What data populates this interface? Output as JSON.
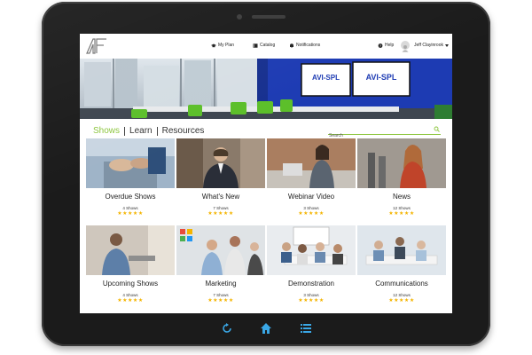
{
  "nav": {
    "my_plan": "My Plan",
    "catalog": "Catalog",
    "notifications": "Notifications",
    "help": "Help",
    "user_name": "Jeff Clayinrook"
  },
  "hero": {
    "sign_left": "AVI-SPL",
    "sign_right": "AVI-SPL"
  },
  "tabs": [
    {
      "label": "Shows",
      "active": true
    },
    {
      "label": "Learn",
      "active": false
    },
    {
      "label": "Resources",
      "active": false
    }
  ],
  "search": {
    "placeholder": "Search"
  },
  "cards": [
    {
      "title": "Overdue Shows",
      "count": "4 Shows",
      "rating": 5
    },
    {
      "title": "What's New",
      "count": "7 Shows",
      "rating": 5
    },
    {
      "title": "Webinar Video",
      "count": "3 Shows",
      "rating": 5
    },
    {
      "title": "News",
      "count": "12 Shows",
      "rating": 5
    },
    {
      "title": "Upcoming Shows",
      "count": "4 Shows",
      "rating": 5
    },
    {
      "title": "Marketing",
      "count": "7 Shows",
      "rating": 5
    },
    {
      "title": "Demonstration",
      "count": "3 Shows",
      "rating": 5
    },
    {
      "title": "Communications",
      "count": "12 Shows",
      "rating": 5
    }
  ],
  "stars_text": "★★★★★",
  "colors": {
    "accent": "#8dc63f",
    "brand_blue": "#1d3bb3",
    "star": "#f4b400",
    "bezel": "#1b1b1b"
  },
  "icons": {
    "bottom": [
      "refresh-icon",
      "home-icon",
      "list-icon"
    ]
  }
}
